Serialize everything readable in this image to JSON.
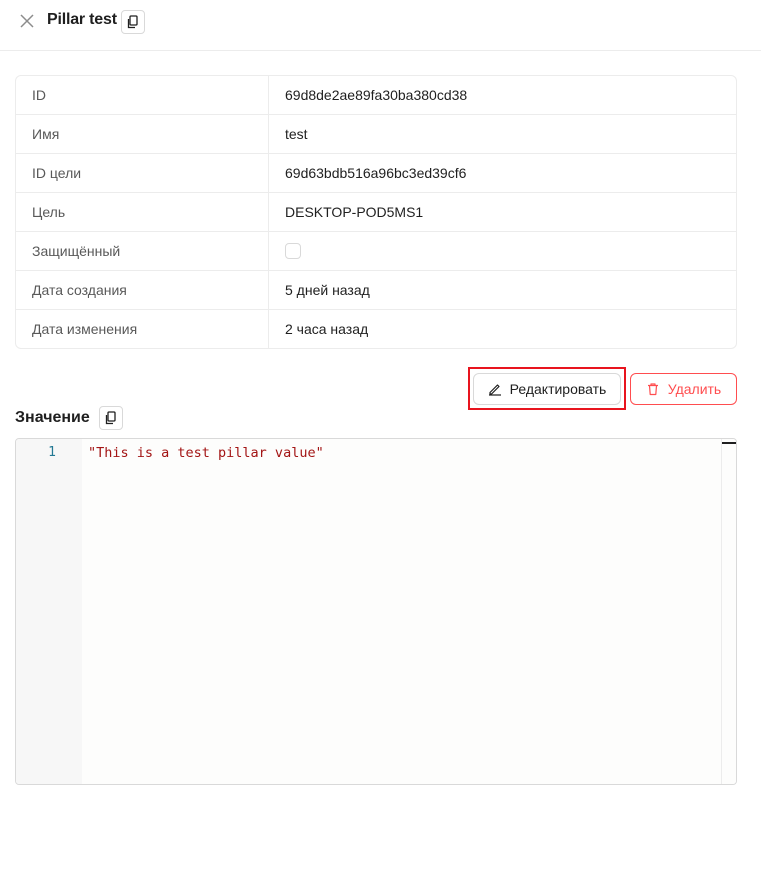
{
  "header": {
    "title": "Pillar test",
    "close_icon": "close-icon",
    "copy_icon": "copy-icon"
  },
  "properties": [
    {
      "label": "ID",
      "value": "69d8de2ae89fa30ba380cd38"
    },
    {
      "label": "Имя",
      "value": "test"
    },
    {
      "label": "ID цели",
      "value": "69d63bdb516a96bc3ed39cf6"
    },
    {
      "label": "Цель",
      "value": "DESKTOP-POD5MS1"
    },
    {
      "label": "Защищённый",
      "checked": false
    },
    {
      "label": "Дата создания",
      "value": "5 дней назад"
    },
    {
      "label": "Дата изменения",
      "value": "2 часа назад"
    }
  ],
  "actions": {
    "edit_label": "Редактировать",
    "edit_icon": "pencil-icon",
    "delete_label": "Удалить",
    "delete_icon": "trash-icon"
  },
  "value_section": {
    "title": "Значение",
    "lines": [
      {
        "number": "1",
        "text": "\"This is a test pillar value\""
      }
    ]
  },
  "colors": {
    "danger": "#ff4d4f",
    "highlight": "#e8141e",
    "string_token": "#a31515"
  }
}
